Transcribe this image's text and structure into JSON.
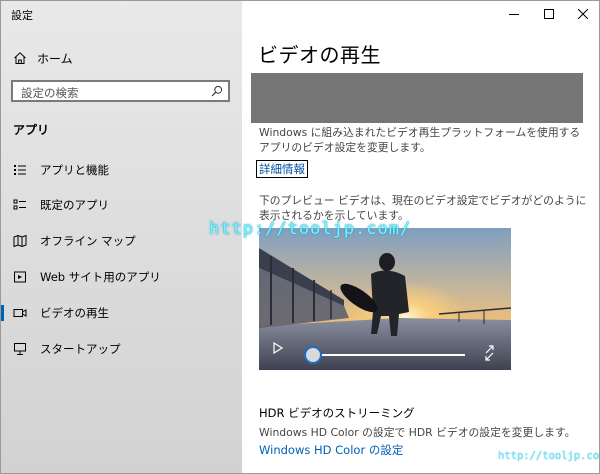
{
  "window": {
    "title": "設定"
  },
  "sidebar": {
    "home_label": "ホーム",
    "search_placeholder": "設定の検索",
    "section_title": "アプリ",
    "items": [
      {
        "label": "アプリと機能",
        "icon": "apps-list-icon"
      },
      {
        "label": "既定のアプリ",
        "icon": "default-apps-icon"
      },
      {
        "label": "オフライン マップ",
        "icon": "offline-map-icon"
      },
      {
        "label": "Web サイト用のアプリ",
        "icon": "web-apps-icon"
      },
      {
        "label": "ビデオの再生",
        "icon": "video-playback-icon",
        "active": true
      },
      {
        "label": "スタートアップ",
        "icon": "startup-icon"
      }
    ]
  },
  "main": {
    "title": "ビデオの再生",
    "description": "Windows に組み込まれたビデオ再生プラットフォームを使用するアプリのビデオ設定を変更します。",
    "more_info_link": "詳細情報",
    "preview_description": "下のプレビュー ビデオは、現在のビデオ設定でビデオがどのように表示されるかを示しています。",
    "video": {
      "progress": 0
    },
    "hdr": {
      "title": "HDR ビデオのストリーミング",
      "description": "Windows HD Color の設定で HDR ビデオの設定を変更します。",
      "link": "Windows HD Color の設定"
    }
  },
  "watermark": {
    "main": "http://tooljp.com/",
    "small": "http://tooljp.com"
  },
  "colors": {
    "accent": "#0063b1",
    "link": "#0060b8",
    "gray_band": "#767676"
  }
}
